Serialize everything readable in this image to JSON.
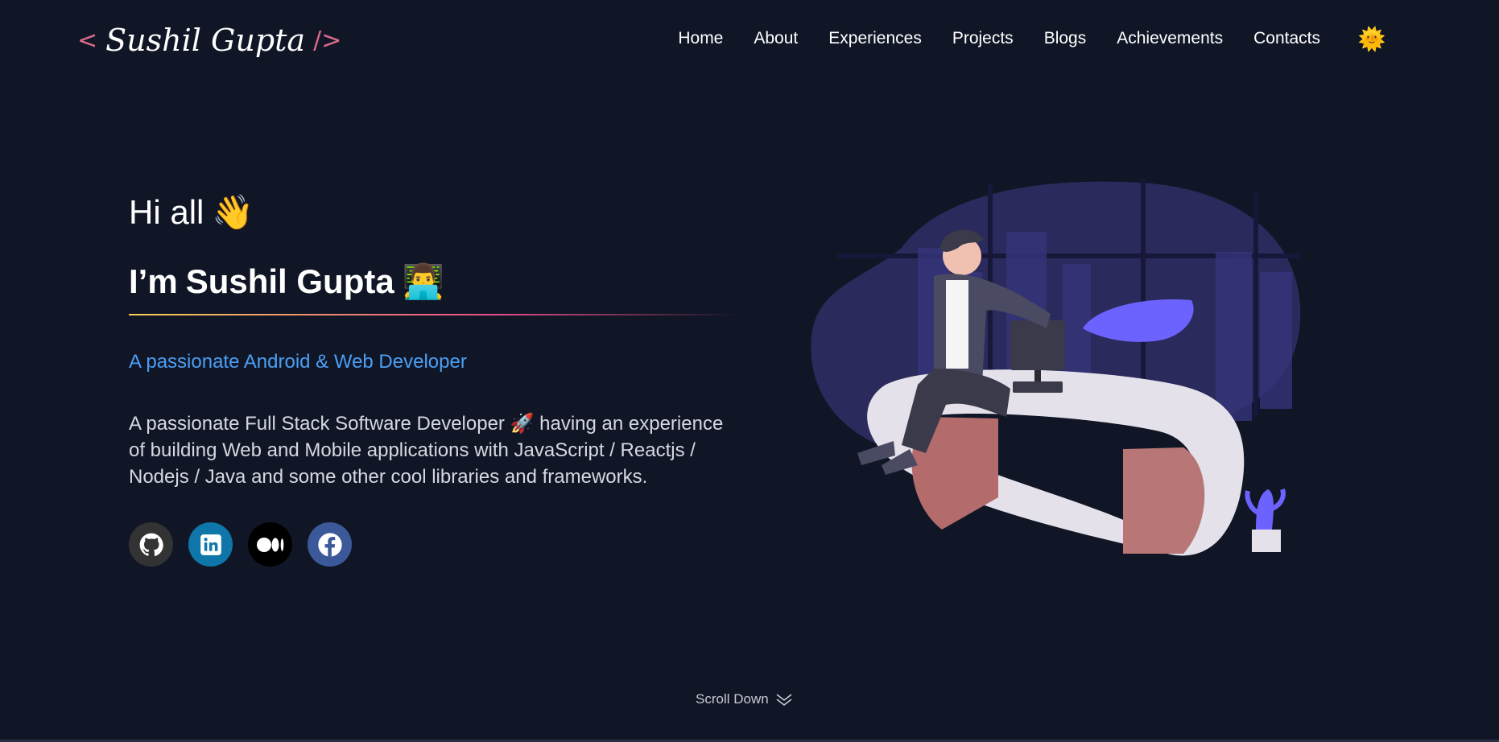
{
  "header": {
    "logo": {
      "open_tag": "<",
      "name": "Sushil Gupta",
      "close_tag": "/>"
    },
    "nav": [
      {
        "label": "Home"
      },
      {
        "label": "About"
      },
      {
        "label": "Experiences"
      },
      {
        "label": "Projects"
      },
      {
        "label": "Blogs"
      },
      {
        "label": "Achievements"
      },
      {
        "label": "Contacts"
      }
    ],
    "theme_toggle_icon": "sun-face-emoji",
    "theme_toggle_glyph": "🌞"
  },
  "hero": {
    "greeting": "Hi all",
    "greeting_emoji": "👋",
    "intro_prefix": "I’m",
    "intro_name": "Sushil Gupta",
    "intro_emoji": "👨‍💻",
    "tagline": "A passionate Android & Web Developer",
    "description": "A passionate Full Stack Software Developer 🚀 having an experience of building Web and Mobile applications with JavaScript / Reactjs / Nodejs / Java and some other cool libraries and frameworks.",
    "social": [
      {
        "name": "github",
        "icon": "github-icon",
        "color": "#333333"
      },
      {
        "name": "linkedin",
        "icon": "linkedin-icon",
        "color": "#0e76a8"
      },
      {
        "name": "medium",
        "icon": "medium-icon",
        "color": "#000000"
      },
      {
        "name": "facebook",
        "icon": "facebook-icon",
        "color": "#3b5998"
      }
    ]
  },
  "scroll": {
    "label": "Scroll Down",
    "icon": "double-chevron-down-icon"
  },
  "colors": {
    "background": "#111627",
    "tagline": "#4a9ff5",
    "logo_tag": "#d76b87",
    "divider_start": "#f7d154",
    "divider_end": "#e84d8a"
  }
}
